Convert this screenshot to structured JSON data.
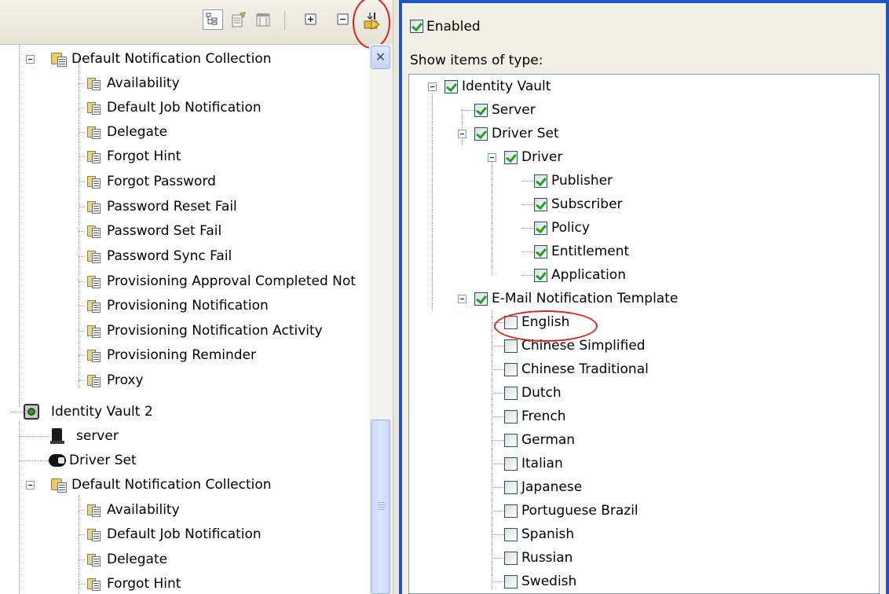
{
  "toolbar": {
    "buttons": [
      {
        "name": "tree-view-icon",
        "pressed": true
      },
      {
        "name": "outline-view-icon",
        "pressed": false
      },
      {
        "name": "filter-view-icon",
        "pressed": false
      },
      {
        "name": "expand-all-icon",
        "pressed": false
      },
      {
        "name": "collapse-all-icon",
        "pressed": false
      },
      {
        "name": "show-items-icon",
        "pressed": false
      }
    ]
  },
  "left_tree": {
    "items": [
      "Default Notification Collection",
      "Availability",
      "Default Job Notification",
      "Delegate",
      "Forgot Hint",
      "Forgot Password",
      "Password Reset Fail",
      "Password Set Fail",
      "Password Sync Fail",
      "Provisioning Approval Completed Not",
      "Provisioning Notification",
      "Provisioning Notification Activity",
      "Provisioning Reminder",
      "Proxy",
      "Identity Vault 2",
      "server",
      "Driver Set",
      "Default Notification Collection",
      "Availability",
      "Default Job Notification",
      "Delegate",
      "Forgot Hint"
    ]
  },
  "filter": {
    "enabled_label": "Enabled",
    "enabled_checked": true,
    "show_items_label": "Show items of type:",
    "items": [
      {
        "label": "Identity Vault",
        "checked": true
      },
      {
        "label": "Server",
        "checked": true
      },
      {
        "label": "Driver Set",
        "checked": true
      },
      {
        "label": "Driver",
        "checked": true
      },
      {
        "label": "Publisher",
        "checked": true
      },
      {
        "label": "Subscriber",
        "checked": true
      },
      {
        "label": "Policy",
        "checked": true
      },
      {
        "label": "Entitlement",
        "checked": true
      },
      {
        "label": "Application",
        "checked": true
      },
      {
        "label": "E-Mail Notification Template",
        "checked": true
      },
      {
        "label": "English",
        "checked": false
      },
      {
        "label": "Chinese Simplified",
        "checked": false
      },
      {
        "label": "Chinese Traditional",
        "checked": false
      },
      {
        "label": "Dutch",
        "checked": false
      },
      {
        "label": "French",
        "checked": false
      },
      {
        "label": "German",
        "checked": false
      },
      {
        "label": "Italian",
        "checked": false
      },
      {
        "label": "Japanese",
        "checked": false
      },
      {
        "label": "Portuguese Brazil",
        "checked": false
      },
      {
        "label": "Spanish",
        "checked": false
      },
      {
        "label": "Russian",
        "checked": false
      },
      {
        "label": "Swedish",
        "checked": false
      }
    ]
  },
  "colors": {
    "highlight": "#e0201a",
    "active_border": "#2055c9",
    "check": "#21a121"
  }
}
